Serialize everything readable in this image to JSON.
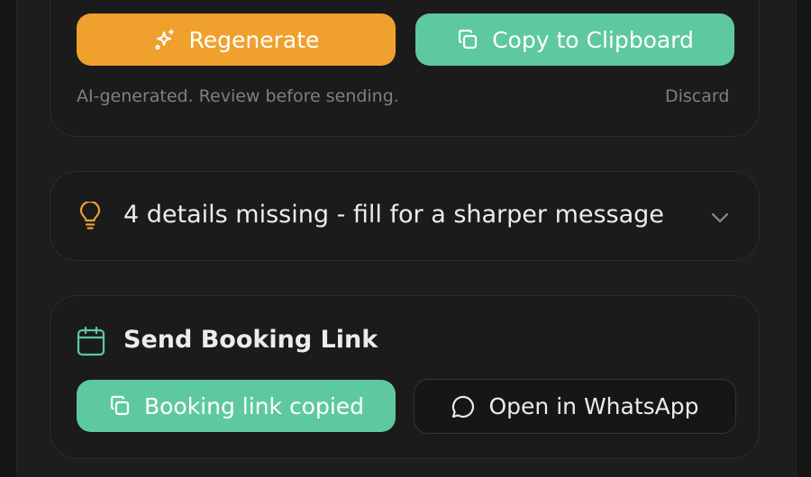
{
  "ai_reply": {
    "regenerate_label": "Regenerate",
    "regenerate_icon": "sparkles-icon",
    "copy_label": "Copy to Clipboard",
    "copy_icon": "copy-icon",
    "note": "AI-generated. Review before sending.",
    "discard_label": "Discard"
  },
  "tips": {
    "icon": "lightbulb-icon",
    "text": "4 details missing - fill for a sharper message",
    "expand_icon": "chevron-down-icon"
  },
  "booking": {
    "icon": "calendar-icon",
    "title": "Send Booking Link",
    "copied_label": "Booking link copied",
    "copied_icon": "copy-icon",
    "whatsapp_label": "Open in WhatsApp",
    "whatsapp_icon": "chat-bubble-icon"
  },
  "colors": {
    "background": "#1d1d1e",
    "card": "#1b1b1c",
    "accent_orange": "#f0a12d",
    "accent_green": "#5ec99f",
    "muted_text": "#7f7f84",
    "primary_text": "#ececec"
  }
}
